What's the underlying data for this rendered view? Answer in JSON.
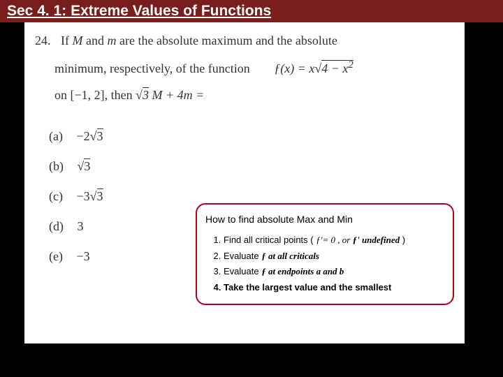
{
  "title": {
    "sec": "Sec 4. 1: ",
    "rest": "Extreme Values of Functions"
  },
  "question": {
    "number": "24.",
    "line1_a": "If  ",
    "M": "M",
    "line1_b": "  and  ",
    "m": "m",
    "line1_c": "  are the absolute maximum and the absolute",
    "line2_a": "minimum, respectively, of the function",
    "fx_label": "ƒ(x) = x",
    "fx_sqrt": "4 − x",
    "fx_sup": "2",
    "line3_a": "on   [−1, 2],   then ",
    "expr_sqrt": "3",
    "expr_rest": " M + 4m ="
  },
  "options": [
    {
      "label": "(a)",
      "prefix": "−2",
      "sqrt": "3",
      "suffix": ""
    },
    {
      "label": "(b)",
      "prefix": "",
      "sqrt": "3",
      "suffix": ""
    },
    {
      "label": "(c)",
      "prefix": "−3",
      "sqrt": "3",
      "suffix": ""
    },
    {
      "label": "(d)",
      "prefix": "3",
      "sqrt": "",
      "suffix": ""
    },
    {
      "label": "(e)",
      "prefix": "−3",
      "sqrt": "",
      "suffix": ""
    }
  ],
  "info": {
    "title": "How to find absolute Max and Min",
    "items": [
      {
        "a": "Find all critical points ( ",
        "b": "ƒ'= 0 , or ",
        "c": "ƒ' undefined",
        "d": " )"
      },
      {
        "a": "Evaluate ",
        "b": "ƒ at all criticals",
        "c": "",
        "d": ""
      },
      {
        "a": "Evaluate ",
        "b": "ƒ  at endpoints  a and b",
        "c": "",
        "d": ""
      },
      {
        "a": "Take the largest value and the smallest",
        "b": "",
        "c": "",
        "d": ""
      }
    ]
  }
}
